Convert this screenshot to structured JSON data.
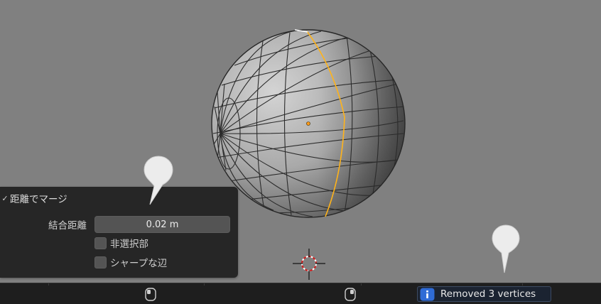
{
  "operator_panel": {
    "title": "距離でマージ",
    "merge_distance_label": "結合距離",
    "merge_distance_value": "0.02 m",
    "unselected_label": "非選択部",
    "unselected_checked": false,
    "sharp_edges_label": "シャープな辺",
    "sharp_edges_checked": false
  },
  "status_bar": {
    "report_message": "Removed 3 vertices",
    "report_icon": "info-icon"
  },
  "colors": {
    "viewport_bg": "#808080",
    "panel_bg": "#262626",
    "seam_highlight": "#ffb31a",
    "report_bg": "#1b2331",
    "report_icon_bg": "#2f6bd6"
  }
}
